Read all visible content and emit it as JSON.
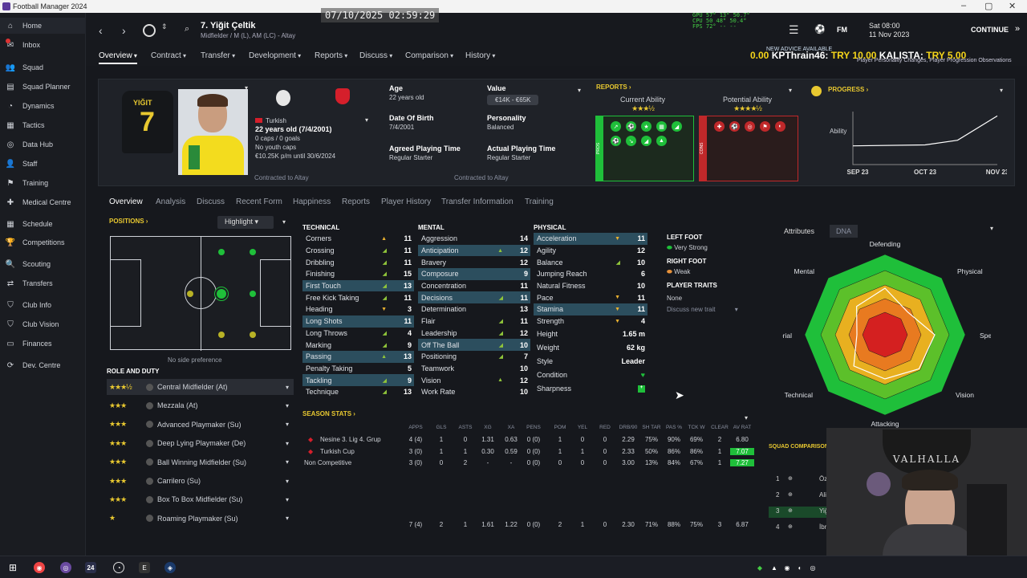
{
  "window": {
    "title": "Football Manager 2024"
  },
  "sidebar": {
    "items": [
      {
        "label": "Home",
        "icon": "home-icon",
        "glyph": "⌂"
      },
      {
        "label": "Inbox",
        "icon": "inbox-icon",
        "glyph": "✉"
      },
      {
        "label": "Squad",
        "icon": "squad-icon",
        "glyph": "👥"
      },
      {
        "label": "Squad Planner",
        "icon": "planner-icon",
        "glyph": "▤"
      },
      {
        "label": "Dynamics",
        "icon": "dynamics-icon",
        "glyph": "◔"
      },
      {
        "label": "Tactics",
        "icon": "tactics-icon",
        "glyph": "▦"
      },
      {
        "label": "Data Hub",
        "icon": "datahub-icon",
        "glyph": "◎"
      },
      {
        "label": "Staff",
        "icon": "staff-icon",
        "glyph": "👤"
      },
      {
        "label": "Training",
        "icon": "training-icon",
        "glyph": "⚑"
      },
      {
        "label": "Medical Centre",
        "icon": "medical-icon",
        "glyph": "✚"
      },
      {
        "label": "Schedule",
        "icon": "schedule-icon",
        "glyph": "▦"
      },
      {
        "label": "Competitions",
        "icon": "trophy-icon",
        "glyph": "🏆"
      },
      {
        "label": "Scouting",
        "icon": "scouting-icon",
        "glyph": "🔍"
      },
      {
        "label": "Transfers",
        "icon": "transfers-icon",
        "glyph": "⇄"
      },
      {
        "label": "Club Info",
        "icon": "clubinfo-icon",
        "glyph": "⛉"
      },
      {
        "label": "Club Vision",
        "icon": "clubvision-icon",
        "glyph": "⛉"
      },
      {
        "label": "Finances",
        "icon": "finances-icon",
        "glyph": "▭"
      },
      {
        "label": "Dev. Centre",
        "icon": "devcentre-icon",
        "glyph": "⟳"
      }
    ]
  },
  "topbar": {
    "player_number_name": "7. Yiğit Çeltik",
    "player_sub": "Midfielder / M (L), AM (LC) - Altay",
    "timestamp": "07/10/2025 02:59:29",
    "perf": "GPU 57° 13° 50.7°\nCPU 50 48° 50.4°\nFPS 72° -- --",
    "date_line1": "Sat 08:00",
    "date_line2": "11 Nov 2023",
    "fm_label": "FM",
    "continue_label": "CONTINUE",
    "advice_label": "NEW ADVICE AVAILABLE",
    "advice_sub": "Player Personality Changes, Player Progression Observations"
  },
  "ticker": {
    "lead": "0.00",
    "name": "KPThrain46:",
    "text": "TRY 10.00",
    "name2": "KALISTA:",
    "text2": "TRY 5.00"
  },
  "menu": {
    "items": [
      "Overview",
      "Contract",
      "Transfer",
      "Development",
      "Reports",
      "Discuss",
      "Comparison",
      "History"
    ]
  },
  "header": {
    "kit_name": "YIĞIT",
    "kit_number": "7",
    "nationality": "Turkish",
    "age_line": "22 years old (7/4/2001)",
    "caps": "0 caps / 0 goals",
    "youth_caps": "No youth caps",
    "wage": "€10.25K p/m until 30/6/2024",
    "contracted": "Contracted to Altay",
    "age_label": "Age",
    "age_value": "22 years old",
    "value_label": "Value",
    "value_value": "€14K - €65K",
    "dob_label": "Date Of Birth",
    "dob_value": "7/4/2001",
    "personality_label": "Personality",
    "personality_value": "Balanced",
    "agreed_label": "Agreed Playing Time",
    "agreed_value": "Regular Starter",
    "actual_label": "Actual Playing Time",
    "actual_value": "Regular Starter",
    "contracted2": "Contracted to Altay",
    "reports_label": "REPORTS",
    "ca_label": "Current Ability",
    "ca_stars": "★★★½",
    "pa_label": "Potential Ability",
    "pa_stars": "★★★★½",
    "pros_label": "PROS",
    "cons_label": "CONS",
    "progress_label": "PROGRESS",
    "progress_ylabel": "Ability"
  },
  "chart_data": {
    "type": "line",
    "title": "PROGRESS",
    "xlabel": "",
    "ylabel": "Ability",
    "categories": [
      "SEP 23",
      "OCT 23",
      "NOV 23"
    ],
    "x": [
      0,
      1,
      1.45,
      2
    ],
    "values": [
      1,
      1.05,
      1.3,
      2.6
    ],
    "ylim": [
      0,
      3
    ],
    "grid": false
  },
  "subtabs": [
    "Overview",
    "Analysis",
    "Discuss",
    "Recent Form",
    "Happiness",
    "Reports",
    "Player History",
    "Transfer Information",
    "Training"
  ],
  "positions": {
    "label": "POSITIONS",
    "highlight": "Highlight",
    "no_side": "No side preference"
  },
  "roles": {
    "heading": "ROLE AND DUTY",
    "items": [
      {
        "stars": "★★★½",
        "label": "Central Midfielder (At)"
      },
      {
        "stars": "★★★",
        "label": "Mezzala (At)"
      },
      {
        "stars": "★★★",
        "label": "Advanced Playmaker (Su)"
      },
      {
        "stars": "★★★",
        "label": "Deep Lying Playmaker (De)"
      },
      {
        "stars": "★★★",
        "label": "Ball Winning Midfielder (Su)"
      },
      {
        "stars": "★★★",
        "label": "Carrilero (Su)"
      },
      {
        "stars": "★★★",
        "label": "Box To Box Midfielder (Su)"
      },
      {
        "stars": "★",
        "label": "Roaming Playmaker (Su)"
      }
    ]
  },
  "attributes": {
    "technical_label": "TECHNICAL",
    "mental_label": "MENTAL",
    "physical_label": "PHYSICAL",
    "technical": [
      {
        "name": "Corners",
        "value": "11",
        "arrow": "▲",
        "dir": "dn",
        "hl": false
      },
      {
        "name": "Crossing",
        "value": "11",
        "arrow": "◢",
        "dir": "up",
        "hl": false
      },
      {
        "name": "Dribbling",
        "value": "11",
        "arrow": "◢",
        "dir": "up",
        "hl": false
      },
      {
        "name": "Finishing",
        "value": "15",
        "arrow": "◢",
        "dir": "up",
        "hl": false
      },
      {
        "name": "First Touch",
        "value": "13",
        "arrow": "◢",
        "dir": "up",
        "hl": true
      },
      {
        "name": "Free Kick Taking",
        "value": "11",
        "arrow": "◢",
        "dir": "up",
        "hl": false
      },
      {
        "name": "Heading",
        "value": "3",
        "arrow": "▼",
        "dir": "dn",
        "hl": false
      },
      {
        "name": "Long Shots",
        "value": "11",
        "arrow": "",
        "dir": "up",
        "hl": true
      },
      {
        "name": "Long Throws",
        "value": "4",
        "arrow": "◢",
        "dir": "up",
        "hl": false
      },
      {
        "name": "Marking",
        "value": "9",
        "arrow": "◢",
        "dir": "up",
        "hl": false
      },
      {
        "name": "Passing",
        "value": "13",
        "arrow": "▲",
        "dir": "up",
        "hl": true
      },
      {
        "name": "Penalty Taking",
        "value": "5",
        "arrow": "",
        "dir": "up",
        "hl": false
      },
      {
        "name": "Tackling",
        "value": "9",
        "arrow": "◢",
        "dir": "up",
        "hl": true
      },
      {
        "name": "Technique",
        "value": "13",
        "arrow": "◢",
        "dir": "up",
        "hl": false
      }
    ],
    "mental": [
      {
        "name": "Aggression",
        "value": "14",
        "arrow": "",
        "dir": "up",
        "hl": false
      },
      {
        "name": "Anticipation",
        "value": "12",
        "arrow": "▲",
        "dir": "up",
        "hl": true
      },
      {
        "name": "Bravery",
        "value": "12",
        "arrow": "",
        "dir": "up",
        "hl": false
      },
      {
        "name": "Composure",
        "value": "9",
        "arrow": "",
        "dir": "up",
        "hl": true
      },
      {
        "name": "Concentration",
        "value": "11",
        "arrow": "",
        "dir": "up",
        "hl": false
      },
      {
        "name": "Decisions",
        "value": "11",
        "arrow": "◢",
        "dir": "up",
        "hl": true
      },
      {
        "name": "Determination",
        "value": "13",
        "arrow": "",
        "dir": "up",
        "hl": false
      },
      {
        "name": "Flair",
        "value": "11",
        "arrow": "◢",
        "dir": "up",
        "hl": false
      },
      {
        "name": "Leadership",
        "value": "12",
        "arrow": "◢",
        "dir": "up",
        "hl": false
      },
      {
        "name": "Off The Ball",
        "value": "10",
        "arrow": "◢",
        "dir": "up",
        "hl": true
      },
      {
        "name": "Positioning",
        "value": "7",
        "arrow": "◢",
        "dir": "up",
        "hl": false
      },
      {
        "name": "Teamwork",
        "value": "10",
        "arrow": "",
        "dir": "up",
        "hl": false
      },
      {
        "name": "Vision",
        "value": "12",
        "arrow": "▲",
        "dir": "up",
        "hl": false
      },
      {
        "name": "Work Rate",
        "value": "10",
        "arrow": "",
        "dir": "up",
        "hl": false
      }
    ],
    "physical": [
      {
        "name": "Acceleration",
        "value": "11",
        "arrow": "▼",
        "dir": "dn",
        "hl": true
      },
      {
        "name": "Agility",
        "value": "12",
        "arrow": "",
        "dir": "up",
        "hl": false
      },
      {
        "name": "Balance",
        "value": "10",
        "arrow": "◢",
        "dir": "up",
        "hl": false
      },
      {
        "name": "Jumping Reach",
        "value": "6",
        "arrow": "",
        "dir": "up",
        "hl": false
      },
      {
        "name": "Natural Fitness",
        "value": "10",
        "arrow": "",
        "dir": "up",
        "hl": false
      },
      {
        "name": "Pace",
        "value": "11",
        "arrow": "▼",
        "dir": "dn",
        "hl": false
      },
      {
        "name": "Stamina",
        "value": "11",
        "arrow": "▼",
        "dir": "dn",
        "hl": true
      },
      {
        "name": "Strength",
        "value": "4",
        "arrow": "▼",
        "dir": "dn",
        "hl": false
      }
    ],
    "height_label": "Height",
    "height_value": "1.65 m",
    "weight_label": "Weight",
    "weight_value": "62 kg",
    "style_label": "Style",
    "style_value": "Leader",
    "condition_label": "Condition",
    "sharpness_label": "Sharpness"
  },
  "foot": {
    "left_label": "LEFT FOOT",
    "left_value": "Very Strong",
    "right_label": "RIGHT FOOT",
    "right_value": "Weak",
    "traits_label": "PLAYER TRAITS",
    "traits_value": "None",
    "discuss": "Discuss new trait"
  },
  "radar": {
    "tab_attributes": "Attributes",
    "tab_dna": "DNA",
    "axes": [
      "Defending",
      "Physical",
      "Speed",
      "Vision",
      "Attacking",
      "Technical",
      "Aerial",
      "Mental"
    ]
  },
  "season": {
    "label": "SEASON STATS",
    "headers": [
      "APPS",
      "GLS",
      "ASTS",
      "XG",
      "XA",
      "PENS",
      "POM",
      "YEL",
      "RED",
      "DRB/90",
      "SH TAR",
      "PAS %",
      "TCK W",
      "CLEAR",
      "AV RAT"
    ],
    "rows": [
      {
        "comp": "Nesine 3. Lig 4. Grup",
        "vals": [
          "4 (4)",
          "1",
          "0",
          "1.31",
          "0.63",
          "0 (0)",
          "1",
          "0",
          "0",
          "2.29",
          "75%",
          "90%",
          "69%",
          "2",
          "6.80"
        ]
      },
      {
        "comp": "Turkish Cup",
        "vals": [
          "3 (0)",
          "1",
          "1",
          "0.30",
          "0.59",
          "0 (0)",
          "1",
          "1",
          "0",
          "2.33",
          "50%",
          "86%",
          "86%",
          "1",
          "7.07"
        ]
      },
      {
        "comp": "Non Competitive",
        "vals": [
          "3 (0)",
          "0",
          "2",
          "-",
          "-",
          "0 (0)",
          "0",
          "0",
          "0",
          "3.00",
          "13%",
          "84%",
          "67%",
          "1",
          "7.27"
        ]
      }
    ],
    "total": [
      "7 (4)",
      "2",
      "1",
      "1.61",
      "1.22",
      "0 (0)",
      "2",
      "1",
      "0",
      "2.30",
      "71%",
      "88%",
      "75%",
      "3",
      "6.87"
    ]
  },
  "squad": {
    "label": "SQUAD COMPARISON",
    "rows": [
      {
        "n": "1",
        "name": "Öze"
      },
      {
        "n": "2",
        "name": "Ali"
      },
      {
        "n": "3",
        "name": "Yiğ"
      },
      {
        "n": "4",
        "name": "İbr"
      }
    ]
  },
  "webcam": {
    "banner": "VALHALLA"
  },
  "taskbar": {
    "items": [
      "windows-icon",
      "chrome-icon",
      "app-icon",
      "fm24-icon",
      "steam-icon",
      "epic-icon",
      "steam2-icon"
    ]
  }
}
